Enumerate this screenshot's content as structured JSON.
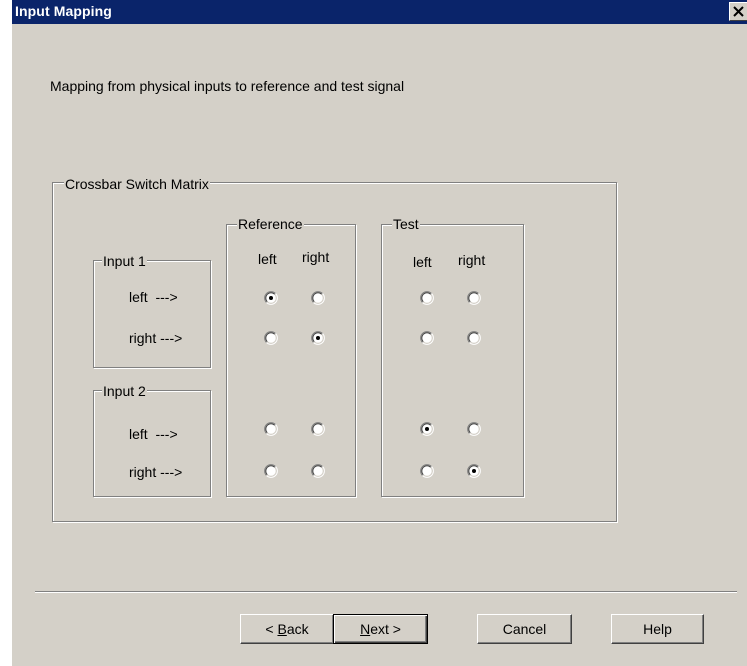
{
  "window": {
    "title": "Input Mapping",
    "close_icon": "close-icon"
  },
  "description": "Mapping from physical inputs to reference and test signal",
  "matrix": {
    "title": "Crossbar Switch Matrix",
    "input1": {
      "title": "Input 1",
      "left": "left  --->",
      "right": "right --->"
    },
    "input2": {
      "title": "Input 2",
      "left": "left  --->",
      "right": "right --->"
    },
    "reference": {
      "title": "Reference",
      "col_left": "left",
      "col_right": "right"
    },
    "test": {
      "title": "Test",
      "col_left": "left",
      "col_right": "right"
    },
    "selection": {
      "input1_left": "reference-left",
      "input1_right": "reference-right",
      "input2_left": "test-left",
      "input2_right": "test-right"
    }
  },
  "buttons": {
    "back_prefix": "< ",
    "back_mnemonic": "B",
    "back_rest": "ack",
    "next_mnemonic": "N",
    "next_rest": "ext >",
    "cancel": "Cancel",
    "help": "Help"
  }
}
